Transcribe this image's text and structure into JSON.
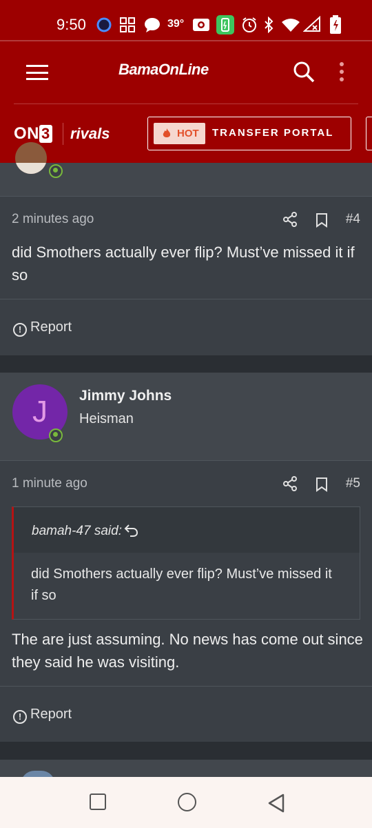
{
  "status_bar": {
    "time": "9:50",
    "temperature": "39°",
    "icons": [
      "assistant-icon",
      "grid-icon",
      "chat-icon",
      "temperature",
      "camera-icon",
      "battery-saver-icon",
      "alarm-icon",
      "bluetooth-icon",
      "wifi-icon",
      "signal-icon",
      "battery-icon"
    ]
  },
  "header": {
    "brand": "BamaOnLine",
    "on3": "ON",
    "on3_num": "3",
    "rivals": "rivals",
    "hot_label": "HOT",
    "portal_label": "TRANSFER PORTAL",
    "accent_color": "#9d0000"
  },
  "posts": [
    {
      "time": "2 minutes ago",
      "number": "#4",
      "body": "did Smothers actually ever flip? Must’ve missed it if so",
      "report_label": "Report"
    },
    {
      "author": {
        "initial": "J",
        "name": "Jimmy Johns",
        "rank": "Heisman",
        "avatar_color": "#7326a8"
      },
      "time": "1 minute ago",
      "number": "#5",
      "quote": {
        "author": "bamah-47 said:",
        "body": "did Smothers actually ever flip? Must’ve missed it if so"
      },
      "body": "The are just assuming. No news has come out since they said he was visiting.",
      "report_label": "Report"
    }
  ],
  "navbar": {
    "buttons": [
      "recents",
      "home",
      "back"
    ]
  }
}
